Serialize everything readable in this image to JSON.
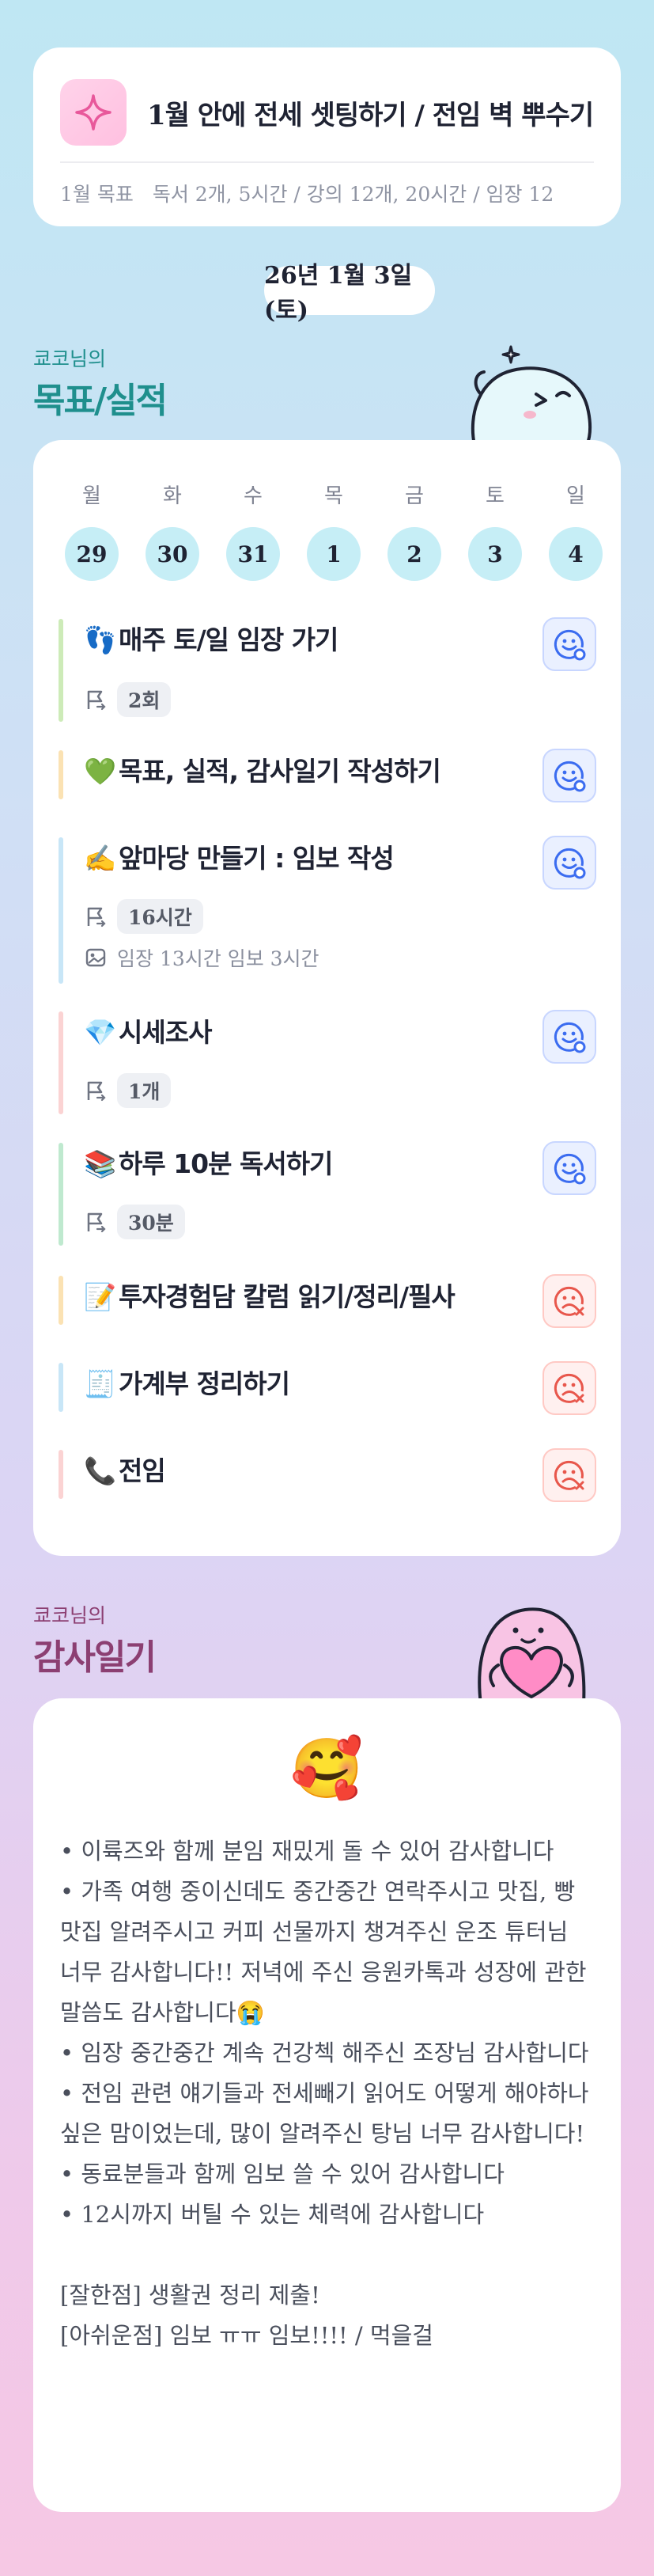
{
  "goal": {
    "title": "1월 안에 전세 셋팅하기 / 전임 벽 뿌수기",
    "label": "1월 목표",
    "summary": "독서 2개, 5시간 / 강의 12개, 20시간 / 임장 12"
  },
  "date": "26년 1월 3일(토)",
  "goals_section": {
    "owner": "쿄코님의",
    "title": "목표/실적"
  },
  "week": {
    "days": [
      "월",
      "화",
      "수",
      "목",
      "금",
      "토",
      "일"
    ],
    "dates": [
      "29",
      "30",
      "31",
      "1",
      "2",
      "3",
      "4"
    ]
  },
  "tasks": [
    {
      "emoji": "👣",
      "title": "매주 토/일 임장 가기",
      "chip": "2회",
      "status": "done"
    },
    {
      "emoji": "💚",
      "title": "목표, 실적, 감사일기 작성하기",
      "status": "done"
    },
    {
      "emoji": "✍️",
      "title": "앞마당 만들기 : 임보 작성",
      "chip": "16시간",
      "note": "임장 13시간 임보 3시간",
      "status": "done"
    },
    {
      "emoji": "💎",
      "title": "시세조사",
      "chip": "1개",
      "status": "done"
    },
    {
      "emoji": "📚",
      "title": "하루 10분 독서하기",
      "chip": "30분",
      "status": "done"
    },
    {
      "emoji": "📝",
      "title": "투자경험담 칼럼 읽기/정리/필사",
      "status": "missed"
    },
    {
      "emoji": "🧾",
      "title": "가계부 정리하기",
      "status": "missed"
    },
    {
      "emoji": "📞",
      "title": "전임",
      "status": "missed"
    }
  ],
  "gratitude_section": {
    "owner": "쿄코님의",
    "title": "감사일기"
  },
  "gratitude": {
    "emoji": "🥰",
    "items": [
      "•  이륙즈와 함께 분임 재밌게 돌 수 있어 감사합니다",
      "•  가족 여행 중이신데도 중간중간 연락주시고 맛집, 빵맛집 알려주시고 커피 선물까지 챙겨주신 운조 튜터님 너무 감사합니다!! 저녁에 주신 응원카톡과 성장에 관한 말씀도 감사합니다😭",
      "•  임장 중간중간 계속 건강첵 해주신 조장님 감사합니다",
      "•  전임 관련 얘기들과 전세빼기 읽어도 어떻게 해야하나 싶은 맘이었는데, 많이 알려주신 탕님 너무 감사합니다!",
      "•  동료분들과 함께 임보 쓸 수 있어 감사합니다",
      "•  12시까지 버틸 수 있는 체력에 감사합니다"
    ],
    "good": "[잘한점] 생활권 정리 제출!",
    "regret": "[아쉬운점] 임보 ㅠㅠ 임보!!!! / 먹을걸"
  },
  "colors": {
    "teal": "#1f8f8d",
    "plum": "#8c3f72",
    "chip_bg": "#eef0f4",
    "done_blue": "#3b6cf0",
    "missed_red": "#e8574c"
  },
  "icons": {
    "goal": "sparkle-icon",
    "flag": "flag-icon",
    "image": "image-icon",
    "done": "smile-check-icon",
    "missed": "sad-x-icon"
  }
}
